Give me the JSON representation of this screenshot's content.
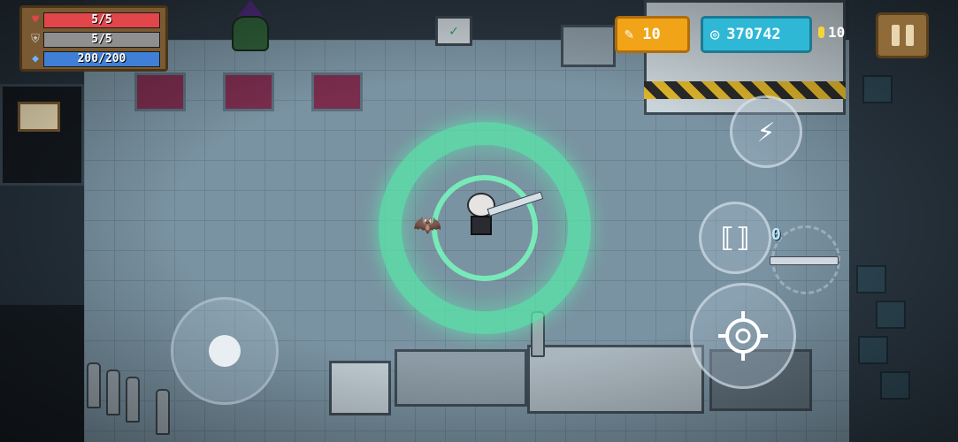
{
  "hud": {
    "health": {
      "text": "5/5",
      "value": 5,
      "max": 5,
      "color": "#e0464a",
      "icon": "heart-icon"
    },
    "armor": {
      "text": "5/5",
      "value": 5,
      "max": 5,
      "color": "#8f8f8f",
      "icon": "shield-icon"
    },
    "energy": {
      "text": "200/200",
      "value": 200,
      "max": 200,
      "color": "#3f7fd6",
      "icon": "diamond-icon"
    }
  },
  "currency": {
    "fish": "10",
    "gems": "370742",
    "coins": "10"
  },
  "controls": {
    "skill_icon": "lightning-icon",
    "swap_icon": "weapon-swap-icon",
    "swap_count": "0",
    "attack_icon": "crosshair-icon",
    "pause_icon": "pause-icon"
  },
  "colors": {
    "portal": "#5ae6aa",
    "fish_chip": "#f2a418",
    "gem_chip": "#2fb8d6"
  }
}
